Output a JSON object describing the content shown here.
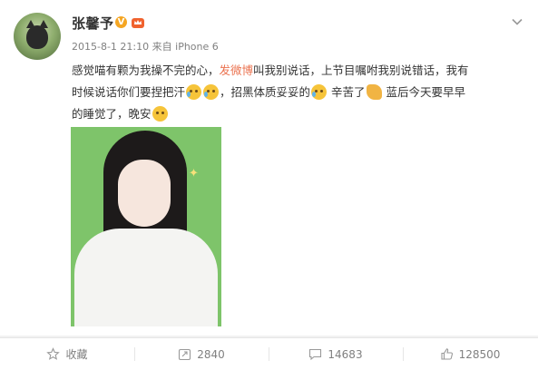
{
  "post": {
    "username": "张馨予",
    "verified_badge": "V",
    "meta_time": "2015-8-1 21:10",
    "meta_source_prefix": "来自",
    "meta_source": "iPhone 6",
    "text_line1_a": "感觉喵有颗为我操不完的心，",
    "text_line1_hl": "发微博",
    "text_line1_b": "叫我别说话，上节目嘱咐我别说错话，我有",
    "text_line2_a": "时候说话你们要捏把汗",
    "text_line2_b": "，招黑体质妥妥的",
    "text_line2_c": " 辛苦了",
    "text_line2_d": " 蓝后今天要早早",
    "text_line3_a": "的睡觉了，晚安",
    "photo_icon": "photo"
  },
  "icons": {
    "avatar": "cat-avatar",
    "crown": "member-crown-icon",
    "menu": "chevron-down-icon",
    "emoji_laugh": "laugh-cry-emoji",
    "emoji_cry": "cry-emoji",
    "emoji_handshake": "handshake-emoji",
    "emoji_sleepy": "sleepy-emoji"
  },
  "toolbar": {
    "favorite_label": "收藏",
    "repost_count": "2840",
    "comment_count": "14683",
    "like_count": "128500"
  },
  "colors": {
    "highlight": "#eb7350",
    "meta_gray": "#808080",
    "text": "#333333",
    "badge": "#f5a623"
  }
}
